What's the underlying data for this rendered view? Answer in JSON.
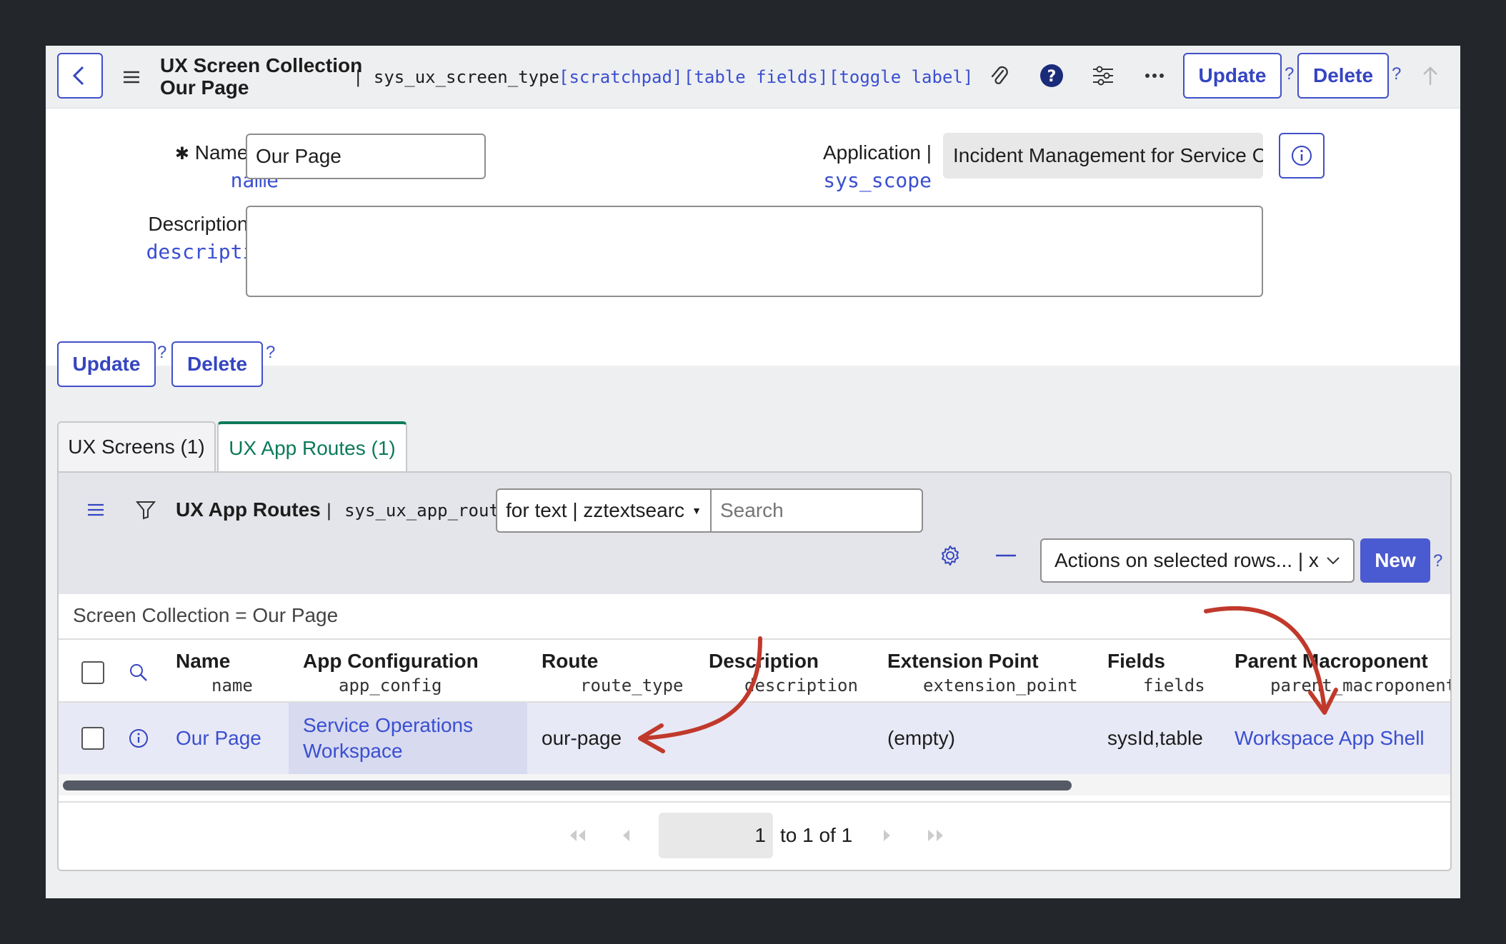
{
  "header": {
    "title_line1": "UX Screen Collection",
    "title_line2": "Our Page",
    "table_name": "| sys_ux_screen_type",
    "link_scratchpad": "[scratchpad]",
    "link_table_fields": "[table fields]",
    "link_toggle_label": "[toggle label]",
    "update_label": "Update",
    "delete_label": "Delete",
    "q": "?"
  },
  "form": {
    "required_mark": "✱",
    "name_label": "Name |",
    "name_field": "name",
    "name_value": "Our Page",
    "application_label": "Application |",
    "application_field": "sys_scope",
    "application_value": "Incident Management for Service C",
    "description_label": "Description |",
    "description_field": "description",
    "description_value": ""
  },
  "actions": {
    "update_label": "Update",
    "delete_label": "Delete",
    "q": "?"
  },
  "tabs": [
    {
      "label": "UX Screens (1)"
    },
    {
      "label": "UX App Routes (1)"
    }
  ],
  "related_list": {
    "title": "UX App Routes",
    "table_name": "| sys_ux_app_route",
    "search_field_select": "for text | zztextsearc",
    "search_placeholder": "Search",
    "actions_select": "Actions on selected rows... | x",
    "new_label": "New",
    "q": "?",
    "breadcrumb": "Screen Collection = Our Page",
    "columns": [
      {
        "label": "Name",
        "field": "name"
      },
      {
        "label": "App Configuration",
        "field": "app_config"
      },
      {
        "label": "Route",
        "field": "route_type"
      },
      {
        "label": "Description",
        "field": "description"
      },
      {
        "label": "Extension Point",
        "field": "extension_point"
      },
      {
        "label": "Fields",
        "field": "fields"
      },
      {
        "label": "Parent Macroponent",
        "field": "parent_macroponent"
      }
    ],
    "rows": [
      {
        "name": "Our Page",
        "app_config_line1": "Service Operations",
        "app_config_line2": "Workspace",
        "route": "our-page",
        "description": "",
        "extension_point": "(empty)",
        "fields": "sysId,table",
        "parent_macroponent": "Workspace App Shell"
      }
    ],
    "pagination": {
      "page_input": "1",
      "summary": "to 1 of 1"
    }
  },
  "colors": {
    "accent": "#3a4fd0",
    "annotation_arrow": "#c0392b",
    "active_tab": "#0c7a5a",
    "selected_row": "#e8e9f6"
  }
}
